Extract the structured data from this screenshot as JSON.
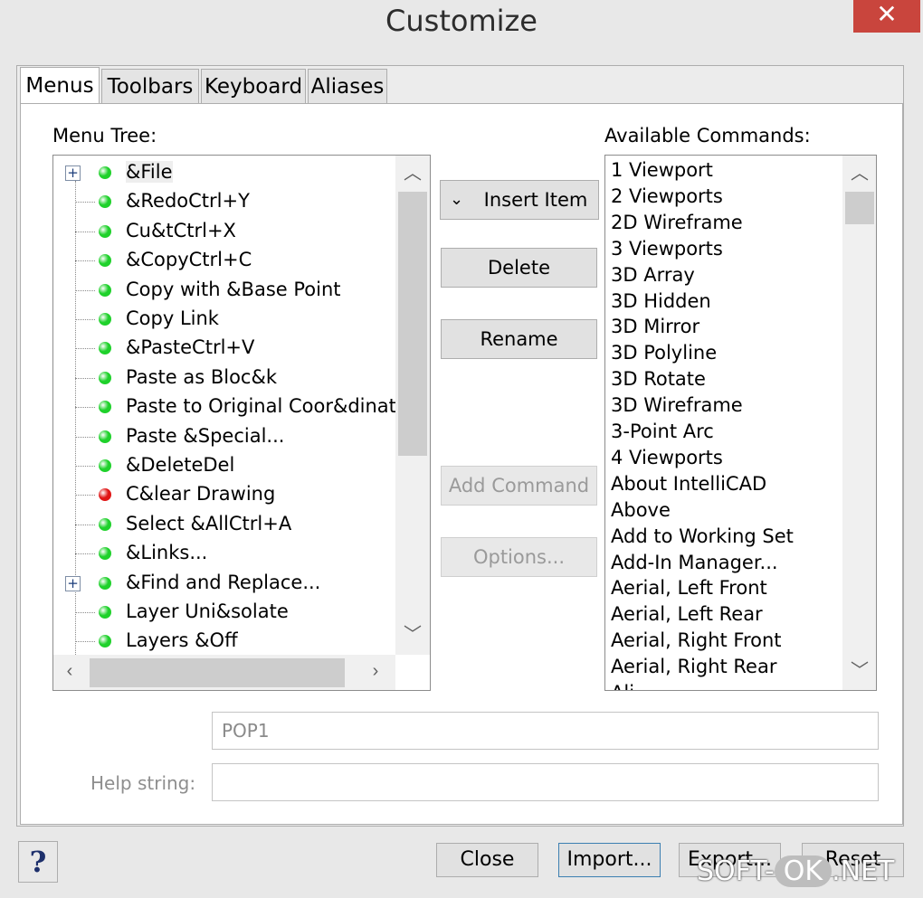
{
  "window": {
    "title": "Customize",
    "close_glyph": "✕"
  },
  "tabs": [
    "Menus",
    "Toolbars",
    "Keyboard",
    "Aliases"
  ],
  "menu_tree": {
    "label": "Menu Tree:",
    "items": [
      {
        "label": "&File",
        "status": "green",
        "expandable": true
      },
      {
        "label": "&RedoCtrl+Y",
        "status": "green"
      },
      {
        "label": "Cu&tCtrl+X",
        "status": "green"
      },
      {
        "label": "&CopyCtrl+C",
        "status": "green"
      },
      {
        "label": "Copy with &Base Point",
        "status": "green"
      },
      {
        "label": "Copy Link",
        "status": "green"
      },
      {
        "label": "&PasteCtrl+V",
        "status": "green"
      },
      {
        "label": "Paste as Bloc&k",
        "status": "green"
      },
      {
        "label": "Paste to Original Coor&dinate",
        "status": "green"
      },
      {
        "label": "Paste &Special...",
        "status": "green"
      },
      {
        "label": "&DeleteDel",
        "status": "green"
      },
      {
        "label": "C&lear Drawing",
        "status": "red"
      },
      {
        "label": "Select &AllCtrl+A",
        "status": "green"
      },
      {
        "label": "&Links...",
        "status": "green"
      },
      {
        "label": "&Find and Replace...",
        "status": "green",
        "expandable": true
      },
      {
        "label": "Layer Uni&solate",
        "status": "green"
      },
      {
        "label": "Layers &Off",
        "status": "green"
      }
    ]
  },
  "middle_buttons": {
    "insert_item": "Insert Item",
    "delete": "Delete",
    "rename": "Rename",
    "add_command": "Add Command",
    "options": "Options..."
  },
  "available_commands": {
    "label": "Available Commands:",
    "items": [
      "1 Viewport",
      "2 Viewports",
      "2D Wireframe",
      "3 Viewports",
      "3D Array",
      "3D Hidden",
      "3D Mirror",
      "3D Polyline",
      "3D Rotate",
      "3D Wireframe",
      "3-Point Arc",
      "4 Viewports",
      "About IntelliCAD",
      "Above",
      "Add to Working Set",
      "Add-In Manager...",
      "Aerial, Left Front",
      "Aerial, Left Rear",
      "Aerial, Right Front",
      "Aerial, Right Rear",
      "Ali..."
    ]
  },
  "fields": {
    "name_value": "POP1",
    "help_label": "Help string:",
    "help_value": ""
  },
  "bottom": {
    "help": "?",
    "close": "Close",
    "import": "Import...",
    "export": "Export...",
    "reset": "Reset"
  },
  "watermark": {
    "left": "SOFT-",
    "mid": "OK",
    "right": ".NET"
  },
  "colors": {
    "status_green": "#1fd12b",
    "status_red": "#e01515",
    "close_button": "#c9453d"
  }
}
